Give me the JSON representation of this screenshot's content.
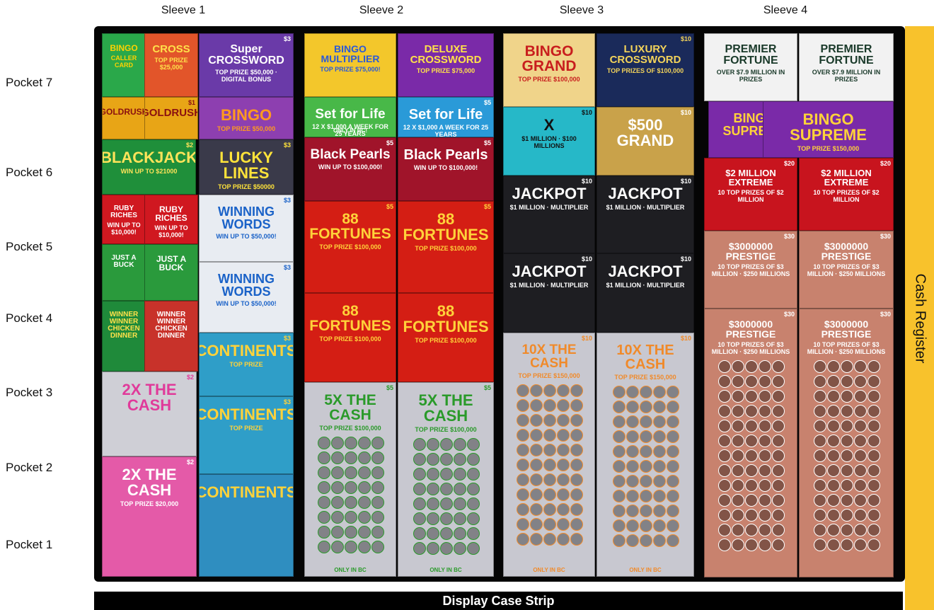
{
  "sleeves": [
    "Sleeve 1",
    "Sleeve 2",
    "Sleeve 3",
    "Sleeve 4"
  ],
  "pockets": [
    "Pocket 7",
    "Pocket 6",
    "Pocket 5",
    "Pocket 4",
    "Pocket 3",
    "Pocket 2",
    "Pocket 1"
  ],
  "side_label": "Cash Register",
  "bottom_label": "Display Case Strip",
  "tickets": [
    {
      "name": "BINGO",
      "sub": "CALLER CARD",
      "price": "",
      "foot": "",
      "bg": "#2aa84a",
      "fg": "#ffd200"
    },
    {
      "name": "CROSS",
      "sub": "TOP PRIZE $25,000",
      "price": "",
      "foot": "",
      "bg": "#e2552a",
      "fg": "#ffe14a"
    },
    {
      "name": "Super CROSSWORD",
      "sub": "TOP PRIZE $50,000 · DIGITAL BONUS",
      "price": "$3",
      "foot": "",
      "bg": "#6a3aa8",
      "fg": "#ffffff"
    },
    {
      "name": "GOLDRUSH",
      "sub": "",
      "price": "",
      "foot": "",
      "bg": "#e8a516",
      "fg": "#8a1010"
    },
    {
      "name": "GOLDRUSH",
      "sub": "",
      "price": "$1",
      "foot": "",
      "bg": "#e8a516",
      "fg": "#8a1010"
    },
    {
      "name": "BINGO",
      "sub": "TOP PRIZE $50,000",
      "price": "",
      "foot": "",
      "bg": "#8d3fb0",
      "fg": "#ff9a1f"
    },
    {
      "name": "BLACKJACK",
      "sub": "WIN UP TO $21000",
      "price": "$2",
      "foot": "",
      "bg": "#1f8f3a",
      "fg": "#ffe35a"
    },
    {
      "name": "LUCKY LINES",
      "sub": "TOP PRIZE $50000",
      "price": "$3",
      "foot": "",
      "bg": "#3a3a4a",
      "fg": "#ffe33a"
    },
    {
      "name": "RUBY RICHES",
      "sub": "WIN UP TO $10,000!",
      "price": "",
      "foot": "",
      "bg": "#d01820",
      "fg": "#ffffff"
    },
    {
      "name": "RUBY RICHES",
      "sub": "WIN UP TO $10,000!",
      "price": "",
      "foot": "",
      "bg": "#d01820",
      "fg": "#ffffff"
    },
    {
      "name": "WINNING WORDS",
      "sub": "WIN UP TO $50,000!",
      "price": "$3",
      "foot": "",
      "bg": "#e8ecf2",
      "fg": "#1a62c8"
    },
    {
      "name": "JUST A BUCK",
      "sub": "",
      "price": "",
      "foot": "",
      "bg": "#2a9a3c",
      "fg": "#ffffff"
    },
    {
      "name": "JUST A BUCK",
      "sub": "",
      "price": "",
      "foot": "",
      "bg": "#2a9a3c",
      "fg": "#ffffff"
    },
    {
      "name": "WINNING WORDS",
      "sub": "WIN UP TO $50,000!",
      "price": "$3",
      "foot": "",
      "bg": "#e8ecf2",
      "fg": "#1a62c8"
    },
    {
      "name": "WINNER WINNER CHICKEN DINNER",
      "sub": "",
      "price": "",
      "foot": "",
      "bg": "#1f8a3a",
      "fg": "#ffe14a"
    },
    {
      "name": "WINNER WINNER CHICKEN DINNER",
      "sub": "",
      "price": "",
      "foot": "",
      "bg": "#c8322a",
      "fg": "#ffffff"
    },
    {
      "name": "CONTINENTS",
      "sub": "TOP PRIZE",
      "price": "$3",
      "foot": "",
      "bg": "#2f9ec8",
      "fg": "#ffd23a"
    },
    {
      "name": "2X THE CASH",
      "sub": "",
      "price": "$2",
      "foot": "",
      "bg": "#cfcfd6",
      "fg": "#e03a9a"
    },
    {
      "name": "CONTINENTS",
      "sub": "TOP PRIZE",
      "price": "$3",
      "foot": "",
      "bg": "#2f9ec8",
      "fg": "#ffd23a"
    },
    {
      "name": "2X THE CASH",
      "sub": "TOP PRIZE $20,000",
      "price": "$2",
      "foot": "",
      "bg": "#e45aa8",
      "fg": "#ffffff"
    },
    {
      "name": "CONTINENTS",
      "sub": "",
      "price": "",
      "foot": "",
      "bg": "#2f8ec0",
      "fg": "#ffd23a"
    },
    {
      "name": "BINGO MULTIPLIER",
      "sub": "TOP PRIZE $75,000!",
      "price": "",
      "foot": "",
      "bg": "#f3c72b",
      "fg": "#2a5ad8"
    },
    {
      "name": "DELUXE CROSSWORD",
      "sub": "TOP PRIZE $75,000",
      "price": "",
      "foot": "",
      "bg": "#7a2aa8",
      "fg": "#ffe14a"
    },
    {
      "name": "Set for Life",
      "sub": "12 X $1,000 A WEEK FOR 25 YEARS",
      "price": "",
      "foot": "ONLY IN BC!",
      "bg": "#48b848",
      "fg": "#ffffff"
    },
    {
      "name": "Set for Life",
      "sub": "12 X $1,000 A WEEK FOR 25 YEARS",
      "price": "$5",
      "foot": "",
      "bg": "#2a9ad8",
      "fg": "#ffffff"
    },
    {
      "name": "Black Pearls",
      "sub": "WIN UP TO $100,000!",
      "price": "$5",
      "foot": "",
      "bg": "#a0142a",
      "fg": "#ffffff"
    },
    {
      "name": "Black Pearls",
      "sub": "WIN UP TO $100,000!",
      "price": "$5",
      "foot": "",
      "bg": "#a0142a",
      "fg": "#ffffff"
    },
    {
      "name": "88 FORTUNES",
      "sub": "TOP PRIZE $100,000",
      "price": "$5",
      "foot": "",
      "bg": "#d41e14",
      "fg": "#ffd23a"
    },
    {
      "name": "88 FORTUNES",
      "sub": "TOP PRIZE $100,000",
      "price": "$5",
      "foot": "",
      "bg": "#d41e14",
      "fg": "#ffd23a"
    },
    {
      "name": "88 FORTUNES",
      "sub": "TOP PRIZE $100,000",
      "price": "",
      "foot": "",
      "bg": "#d41e14",
      "fg": "#ffd23a"
    },
    {
      "name": "88 FORTUNES",
      "sub": "TOP PRIZE $100,000",
      "price": "",
      "foot": "",
      "bg": "#d41e14",
      "fg": "#ffd23a"
    },
    {
      "name": "5X THE CASH",
      "sub": "TOP PRIZE $100,000",
      "price": "$5",
      "foot": "ONLY IN BC",
      "bg": "#c8c8d0",
      "fg": "#2a9a2a"
    },
    {
      "name": "5X THE CASH",
      "sub": "TOP PRIZE $100,000",
      "price": "$5",
      "foot": "ONLY IN BC",
      "bg": "#c8c8d0",
      "fg": "#2a9a2a"
    },
    {
      "name": "BINGO GRAND",
      "sub": "TOP PRIZE $100,000",
      "price": "",
      "foot": "",
      "bg": "#f0d48a",
      "fg": "#c81e1e"
    },
    {
      "name": "LUXURY CROSSWORD",
      "sub": "TOP PRIZES OF $100,000",
      "price": "$10",
      "foot": "",
      "bg": "#1a2a5a",
      "fg": "#f3d35a"
    },
    {
      "name": "X",
      "sub": "$1 MILLION · $100 MILLIONS",
      "price": "$10",
      "foot": "",
      "bg": "#26b8c8",
      "fg": "#111111"
    },
    {
      "name": "$500 GRAND",
      "sub": "",
      "price": "$10",
      "foot": "",
      "bg": "#c9a24a",
      "fg": "#ffffff"
    },
    {
      "name": "JACKPOT",
      "sub": "$1 MILLION · MULTIPLIER",
      "price": "$10",
      "foot": "",
      "bg": "#1e1e22",
      "fg": "#ffffff"
    },
    {
      "name": "JACKPOT",
      "sub": "$1 MILLION · MULTIPLIER",
      "price": "$10",
      "foot": "",
      "bg": "#1e1e22",
      "fg": "#ffffff"
    },
    {
      "name": "JACKPOT",
      "sub": "$1 MILLION · MULTIPLIER",
      "price": "$10",
      "foot": "",
      "bg": "#1e1e22",
      "fg": "#ffffff"
    },
    {
      "name": "JACKPOT",
      "sub": "$1 MILLION · MULTIPLIER",
      "price": "$10",
      "foot": "",
      "bg": "#1e1e22",
      "fg": "#ffffff"
    },
    {
      "name": "10X THE CASH",
      "sub": "TOP PRIZE $150,000",
      "price": "$10",
      "foot": "ONLY IN BC",
      "bg": "#c8c8d0",
      "fg": "#f08a2a"
    },
    {
      "name": "10X THE CASH",
      "sub": "TOP PRIZE $150,000",
      "price": "$10",
      "foot": "ONLY IN BC",
      "bg": "#c8c8d0",
      "fg": "#f08a2a"
    },
    {
      "name": "PREMIER FORTUNE",
      "sub": "OVER $7.9 MILLION IN PRIZES",
      "price": "",
      "foot": "",
      "bg": "#f2f2f2",
      "fg": "#1a3a2a"
    },
    {
      "name": "PREMIER FORTUNE",
      "sub": "OVER $7.9 MILLION IN PRIZES",
      "price": "",
      "foot": "",
      "bg": "#f2f2f2",
      "fg": "#1a3a2a"
    },
    {
      "name": "BINGO SUPREME",
      "sub": "",
      "price": "",
      "foot": "",
      "bg": "#7a2aa8",
      "fg": "#ffd23a"
    },
    {
      "name": "BINGO SUPREME",
      "sub": "TOP PRIZE $150,000",
      "price": "",
      "foot": "",
      "bg": "#7a2aa8",
      "fg": "#ffd23a"
    },
    {
      "name": "$2 MILLION EXTREME",
      "sub": "10 TOP PRIZES OF $2 MILLION",
      "price": "$20",
      "foot": "",
      "bg": "#c8141e",
      "fg": "#ffffff"
    },
    {
      "name": "$2 MILLION EXTREME",
      "sub": "10 TOP PRIZES OF $2 MILLION",
      "price": "$20",
      "foot": "",
      "bg": "#c8141e",
      "fg": "#ffffff"
    },
    {
      "name": "$3000000 PRESTIGE",
      "sub": "10 TOP PRIZES OF $3 MILLION · $250 MILLIONS",
      "price": "$30",
      "foot": "",
      "bg": "#c8826e",
      "fg": "#ffffff"
    },
    {
      "name": "$3000000 PRESTIGE",
      "sub": "10 TOP PRIZES OF $3 MILLION · $250 MILLIONS",
      "price": "$30",
      "foot": "",
      "bg": "#c8826e",
      "fg": "#ffffff"
    },
    {
      "name": "$3000000 PRESTIGE",
      "sub": "10 TOP PRIZES OF $3 MILLION · $250 MILLIONS",
      "price": "$30",
      "foot": "",
      "bg": "#c8826e",
      "fg": "#ffffff"
    },
    {
      "name": "$3000000 PRESTIGE",
      "sub": "10 TOP PRIZES OF $3 MILLION · $250 MILLIONS",
      "price": "$30",
      "foot": "",
      "bg": "#c8826e",
      "fg": "#ffffff"
    }
  ]
}
